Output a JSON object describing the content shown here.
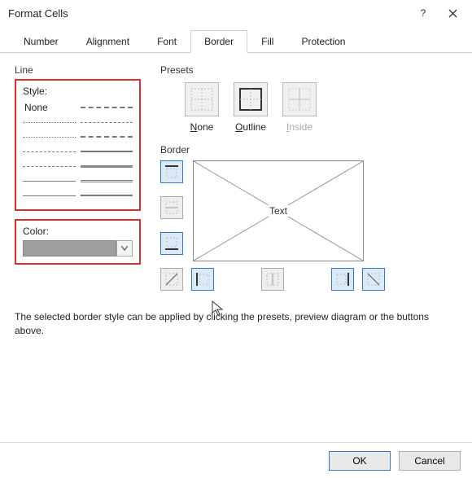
{
  "window": {
    "title": "Format Cells"
  },
  "tabs": {
    "number": "Number",
    "alignment": "Alignment",
    "font": "Font",
    "border": "Border",
    "fill": "Fill",
    "protection": "Protection"
  },
  "line": {
    "legend": "Line",
    "style_label": "Style:",
    "none": "None",
    "color_label": "Color:"
  },
  "presets": {
    "legend": "Presets",
    "none": "None",
    "outline": "Outline",
    "inside": "Inside"
  },
  "border": {
    "legend": "Border",
    "preview_text": "Text"
  },
  "help": "The selected border style can be applied by clicking the presets, preview diagram or the buttons above.",
  "buttons": {
    "ok": "OK",
    "cancel": "Cancel"
  }
}
